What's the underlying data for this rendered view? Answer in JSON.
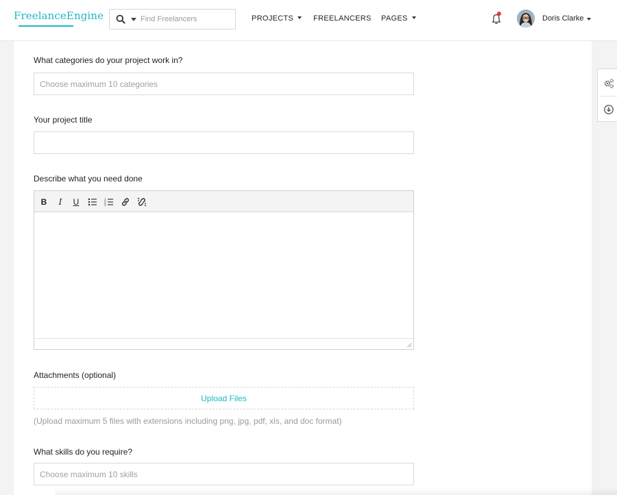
{
  "header": {
    "logo": "FreelanceEngine",
    "search": {
      "placeholder": "Find Freelancers"
    },
    "nav": [
      {
        "label": "PROJECTS"
      },
      {
        "label": "FREELANCERS"
      },
      {
        "label": "PAGES"
      }
    ],
    "user": {
      "name": "Doris Clarke"
    }
  },
  "form": {
    "categories": {
      "label": "What categories do your project work in?",
      "placeholder": "Choose maximum 10 categories"
    },
    "title": {
      "label": "Your project title",
      "value": ""
    },
    "description": {
      "label": "Describe what you need done",
      "toolbar": [
        "bold-icon",
        "italic-icon",
        "underline-icon",
        "bullet-list-icon",
        "numbered-list-icon",
        "link-icon",
        "unlink-icon"
      ]
    },
    "attachments": {
      "label": "Attachments (optional)",
      "button": "Upload Files",
      "hint": "(Upload maximum 5 files with extensions including png, jpg, pdf, xls, and doc format)"
    },
    "skills": {
      "label": "What skills do you require?",
      "placeholder": "Choose maximum 10 skills"
    }
  },
  "side_tools": [
    "gears-icon",
    "download-circle-icon"
  ],
  "colors": {
    "accent": "#1fb8c4",
    "notification": "#e53935"
  }
}
